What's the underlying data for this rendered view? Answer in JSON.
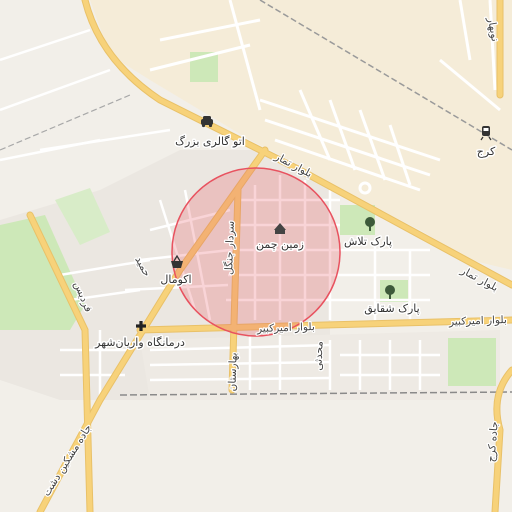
{
  "map": {
    "highlight_color": "#e8525f",
    "colors": {
      "land": "#f2efe9",
      "airport_area": "#f5ecd8",
      "park": "#cde8b8",
      "road_major": "#f7d27a",
      "road_minor": "#ffffff",
      "railway": "#9a9a9a"
    },
    "roads": {
      "tamar": "بلوار تمار",
      "tamar_east": "بلوار تمار",
      "amirkabir_east": "بلوار امیرکبیر",
      "amirkabir_mid": "بلوار امیرکبیر",
      "sardar_jangal": "سردار جنگل",
      "bahar_estan": "بهارستان",
      "mohaddesi": "محدثی",
      "hamid": "حمید",
      "nowbahar": "نوبهار",
      "karaj_road": "جاده کرج",
      "mashkin_dasht_road": "جاده مشکین دشت",
      "fardis": "فردیس",
      "karaj_label": "کرج"
    },
    "pois": {
      "auto_gallery": {
        "label": "اتو گالری بزرگ",
        "icon": "car-icon"
      },
      "zamin_chaman": {
        "label": "زمین چمن",
        "icon": "sports-icon"
      },
      "park_talash": {
        "label": "پارک تلاش",
        "icon": "tree-icon"
      },
      "park_shaghayegh": {
        "label": "پارک شقایق",
        "icon": "tree-icon"
      },
      "okomal": {
        "label": "اکومال",
        "icon": "shopping-basket-icon"
      },
      "clinic": {
        "label": "درمانگاه واریان‌شهر",
        "icon": "medical-cross-icon"
      },
      "station_icon": "train-station-icon"
    }
  }
}
